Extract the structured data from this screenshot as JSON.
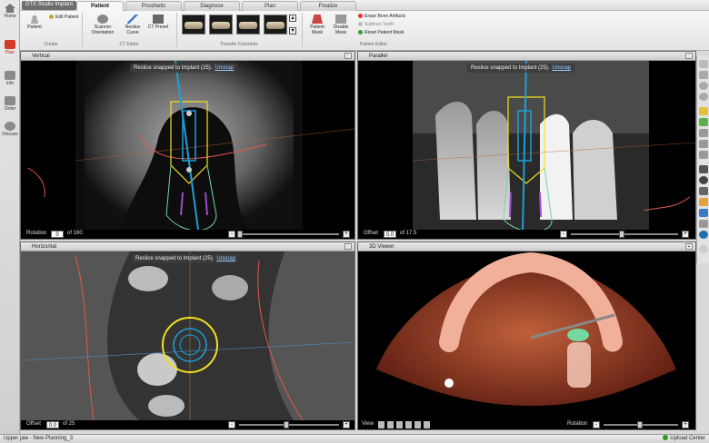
{
  "app": {
    "title": "DTX Studio Implant"
  },
  "leftbar": {
    "items": [
      {
        "label": "Home"
      },
      {
        "label": "Plan"
      },
      {
        "label": "Info"
      },
      {
        "label": "Order"
      },
      {
        "label": "Discuss"
      }
    ]
  },
  "tabs": [
    {
      "label": "Patient",
      "active": true
    },
    {
      "label": "Prosthetic"
    },
    {
      "label": "Diagnose"
    },
    {
      "label": "Plan"
    },
    {
      "label": "Finalize"
    }
  ],
  "ribbon": {
    "patient_btn": "Patient",
    "edit_patient": "Edit Patient",
    "group_create": "Create",
    "scanner_orientation": "Scanner Orientation",
    "reslice_curve": "Reslice Curve",
    "ct_preset": "CT Preset",
    "group_ct": "CT Editor",
    "group_transfer": "Transfer Functions",
    "patient_mask": "Patient Mask",
    "disable_mask": "Disable Mask",
    "erase_bone": "Erase Bone Artifacts",
    "subtract_teeth": "Subtract Teeth",
    "reset_mask": "Reset Patient Mask",
    "group_patient_editor": "Patient Editor"
  },
  "viewports": {
    "vertical": {
      "title": "Vertical",
      "snap": "Reslice snapped to Implant (25).",
      "unsnap": "Unsnap",
      "foot_label": "Rotation",
      "value": "0",
      "of": "of 180"
    },
    "parallel": {
      "title": "Parallel",
      "snap": "Reslice snapped to Implant (25).",
      "unsnap": "Unsnap",
      "foot_label": "Offset",
      "value": "0.0",
      "of": "of 17.5"
    },
    "horizontal": {
      "title": "Horizontal",
      "snap": "Reslice snapped to Implant (25).",
      "unsnap": "Unsnap",
      "foot_label": "Offset",
      "value": "0.0",
      "of": "of 25"
    },
    "viewer3d": {
      "title": "3D Viewer",
      "view_label": "View",
      "rotation_label": "Rotation"
    }
  },
  "status": {
    "left": "Upper jaw - New Planning_3",
    "right": "Upload Center"
  },
  "colors": {
    "implant": "#1e9fd6",
    "yellow": "#f2e020",
    "nerve": "#e05a4a",
    "green": "#74d8a0"
  },
  "icons": [
    "home-icon",
    "plan-icon",
    "info-icon",
    "order-icon",
    "discuss-icon",
    "pan-icon",
    "zoom-icon",
    "undo-icon",
    "redo-icon",
    "ruler-icon"
  ]
}
